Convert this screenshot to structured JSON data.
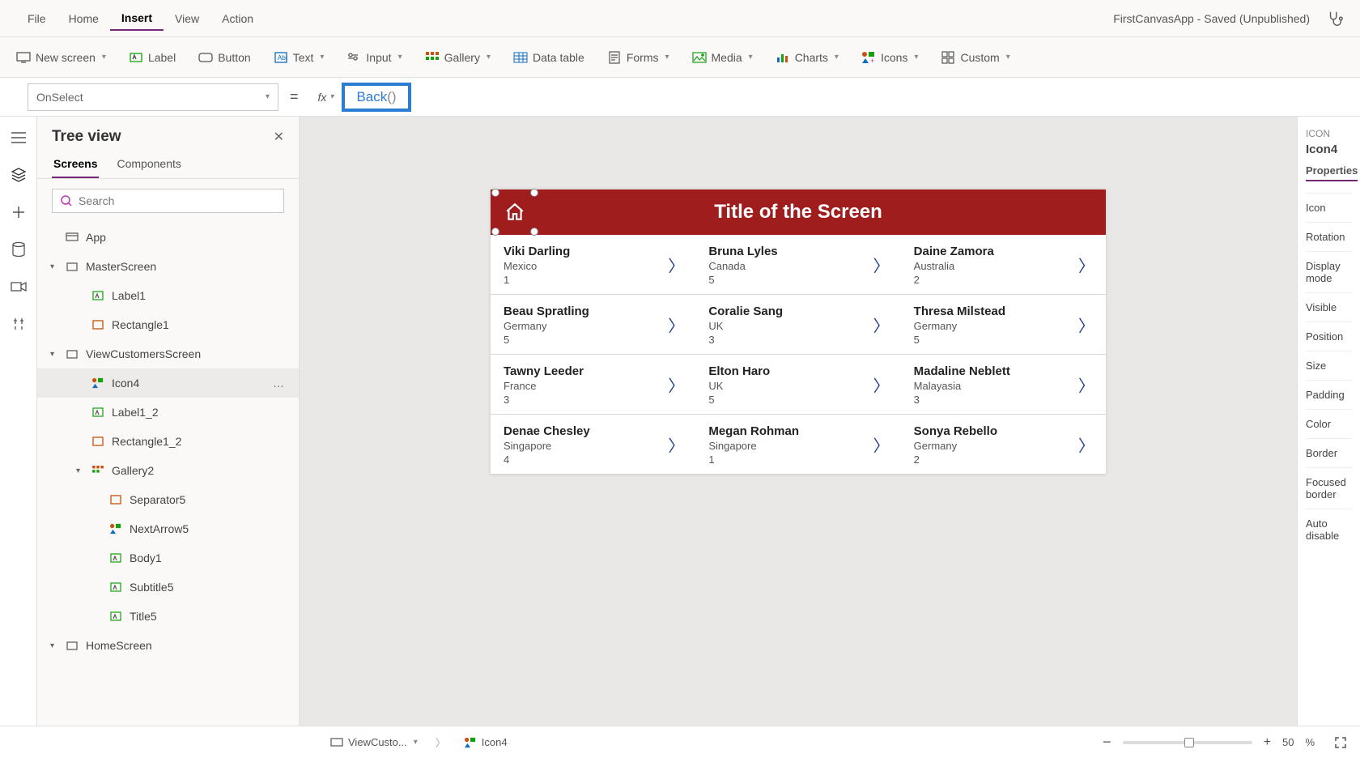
{
  "menubar": {
    "items": [
      "File",
      "Home",
      "Insert",
      "View",
      "Action"
    ],
    "active_index": 2,
    "app_title": "FirstCanvasApp - Saved (Unpublished)"
  },
  "ribbon": {
    "items": [
      {
        "label": "New screen",
        "icon": "screen",
        "chev": true
      },
      {
        "label": "Label",
        "icon": "label",
        "chev": false
      },
      {
        "label": "Button",
        "icon": "button",
        "chev": false
      },
      {
        "label": "Text",
        "icon": "text",
        "chev": true
      },
      {
        "label": "Input",
        "icon": "input",
        "chev": true
      },
      {
        "label": "Gallery",
        "icon": "gallery",
        "chev": true
      },
      {
        "label": "Data table",
        "icon": "datatable",
        "chev": false
      },
      {
        "label": "Forms",
        "icon": "forms",
        "chev": true
      },
      {
        "label": "Media",
        "icon": "media",
        "chev": true
      },
      {
        "label": "Charts",
        "icon": "charts",
        "chev": true
      },
      {
        "label": "Icons",
        "icon": "icons",
        "chev": true
      },
      {
        "label": "Custom",
        "icon": "custom",
        "chev": true
      }
    ]
  },
  "formula": {
    "property": "OnSelect",
    "eq": "=",
    "fx": "fx",
    "keyword": "Back",
    "parens": "()"
  },
  "tree": {
    "title": "Tree view",
    "tabs": [
      "Screens",
      "Components"
    ],
    "active_tab": 0,
    "search_placeholder": "Search",
    "items": [
      {
        "label": "App",
        "indent": 0,
        "icon": "app",
        "caret": ""
      },
      {
        "label": "MasterScreen",
        "indent": 0,
        "icon": "screen",
        "caret": "▾"
      },
      {
        "label": "Label1",
        "indent": 2,
        "icon": "label",
        "caret": ""
      },
      {
        "label": "Rectangle1",
        "indent": 2,
        "icon": "rect",
        "caret": ""
      },
      {
        "label": "ViewCustomersScreen",
        "indent": 0,
        "icon": "screen",
        "caret": "▾"
      },
      {
        "label": "Icon4",
        "indent": 2,
        "icon": "icons",
        "caret": "",
        "selected": true,
        "more": "…"
      },
      {
        "label": "Label1_2",
        "indent": 2,
        "icon": "label",
        "caret": ""
      },
      {
        "label": "Rectangle1_2",
        "indent": 2,
        "icon": "rect",
        "caret": ""
      },
      {
        "label": "Gallery2",
        "indent": 2,
        "icon": "gallery",
        "caret": "▾"
      },
      {
        "label": "Separator5",
        "indent": 3,
        "icon": "rect",
        "caret": ""
      },
      {
        "label": "NextArrow5",
        "indent": 3,
        "icon": "icons",
        "caret": ""
      },
      {
        "label": "Body1",
        "indent": 3,
        "icon": "label",
        "caret": ""
      },
      {
        "label": "Subtitle5",
        "indent": 3,
        "icon": "label",
        "caret": ""
      },
      {
        "label": "Title5",
        "indent": 3,
        "icon": "label",
        "caret": ""
      },
      {
        "label": "HomeScreen",
        "indent": 0,
        "icon": "screen",
        "caret": "▾"
      }
    ]
  },
  "canvas": {
    "screen_title": "Title of the Screen",
    "cells": [
      {
        "name": "Viki Darling",
        "country": "Mexico",
        "num": "1"
      },
      {
        "name": "Bruna Lyles",
        "country": "Canada",
        "num": "5"
      },
      {
        "name": "Daine Zamora",
        "country": "Australia",
        "num": "2"
      },
      {
        "name": "Beau Spratling",
        "country": "Germany",
        "num": "5"
      },
      {
        "name": "Coralie Sang",
        "country": "UK",
        "num": "3"
      },
      {
        "name": "Thresa Milstead",
        "country": "Germany",
        "num": "5"
      },
      {
        "name": "Tawny Leeder",
        "country": "France",
        "num": "3"
      },
      {
        "name": "Elton Haro",
        "country": "UK",
        "num": "5"
      },
      {
        "name": "Madaline Neblett",
        "country": "Malayasia",
        "num": "3"
      },
      {
        "name": "Denae Chesley",
        "country": "Singapore",
        "num": "4"
      },
      {
        "name": "Megan Rohman",
        "country": "Singapore",
        "num": "1"
      },
      {
        "name": "Sonya Rebello",
        "country": "Germany",
        "num": "2"
      }
    ]
  },
  "props": {
    "type_label": "ICON",
    "name": "Icon4",
    "tab": "Properties",
    "rows": [
      "Icon",
      "Rotation",
      "Display mode",
      "Visible",
      "Position",
      "Size",
      "Padding",
      "Color",
      "Border",
      "Focused border",
      "Auto disable"
    ]
  },
  "status": {
    "breadcrumb_screen": "ViewCusto...",
    "breadcrumb_item": "Icon4",
    "zoom_minus": "−",
    "zoom_plus": "+",
    "zoom_value": "50",
    "zoom_pct": "%"
  }
}
